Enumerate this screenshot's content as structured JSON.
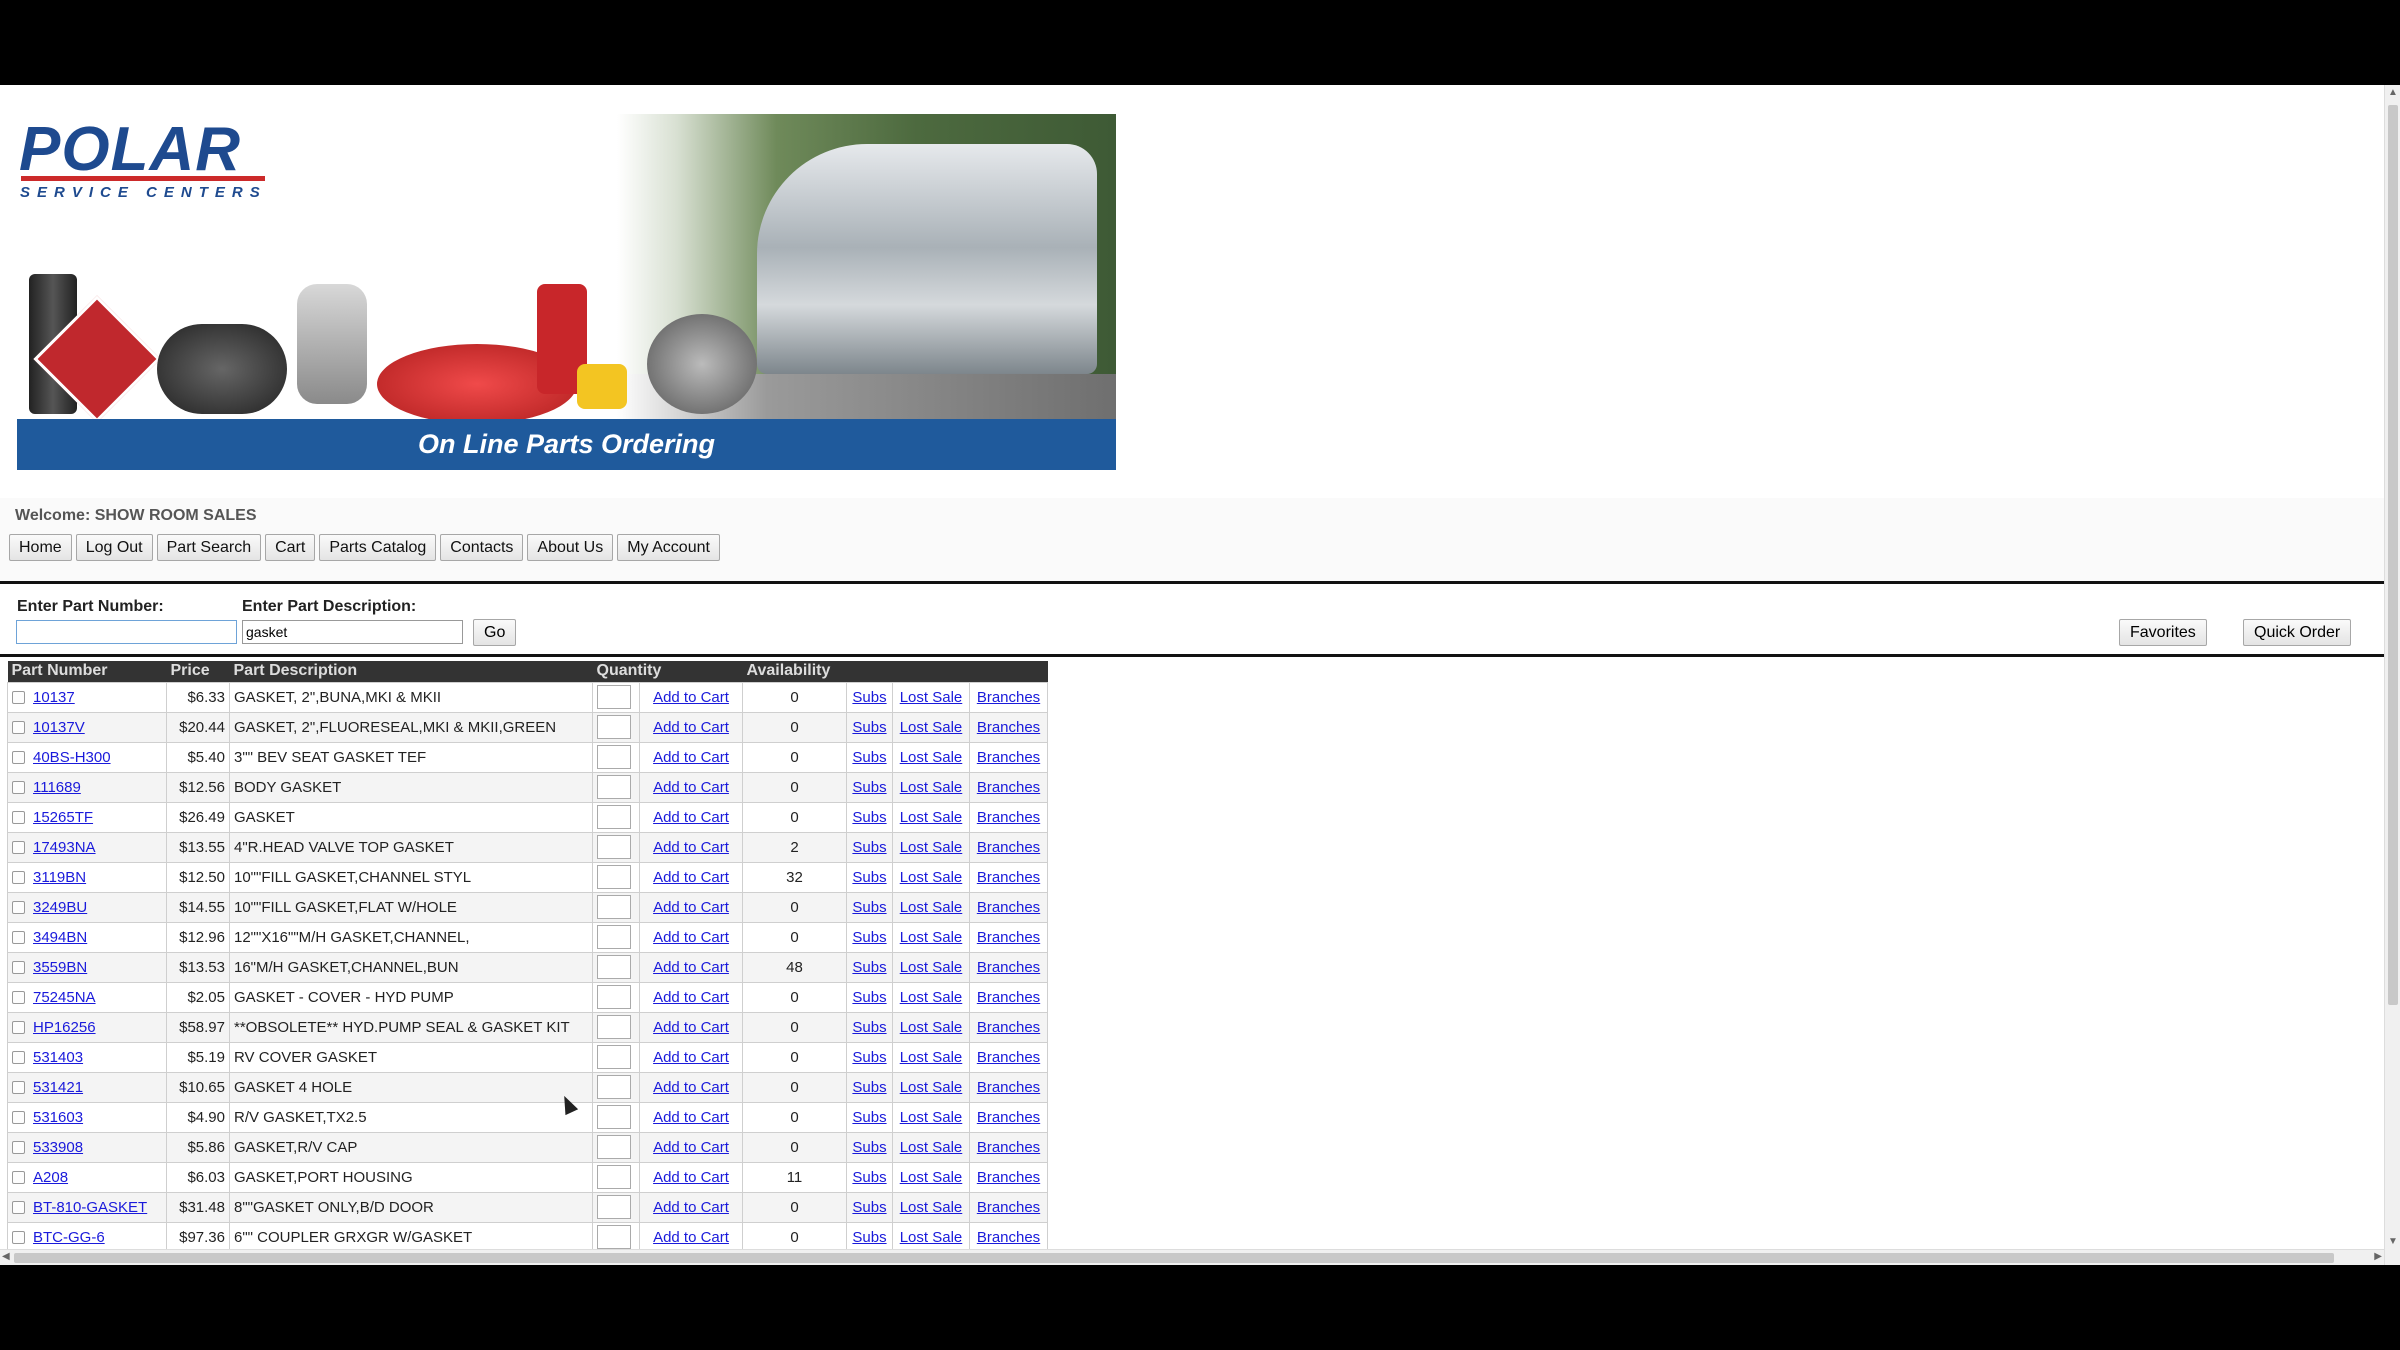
{
  "banner": {
    "logo_text": "POLAR",
    "logo_subtext": "SERVICE CENTERS",
    "strip_text": "On Line Parts Ordering"
  },
  "welcome_text": "Welcome: SHOW ROOM SALES",
  "nav": [
    "Home",
    "Log Out",
    "Part Search",
    "Cart",
    "Parts Catalog",
    "Contacts",
    "About Us",
    "My Account"
  ],
  "search": {
    "part_number_label": "Enter Part Number:",
    "part_number_value": "",
    "part_description_label": "Enter Part Description:",
    "part_description_value": "gasket",
    "go_label": "Go",
    "favorites_label": "Favorites",
    "quick_order_label": "Quick Order"
  },
  "table": {
    "headers": [
      "Part Number",
      "Price",
      "Part Description",
      "Quantity",
      "Availability"
    ],
    "add_label": "Add to Cart",
    "subs_label": "Subs",
    "lost_label": "Lost Sale",
    "branches_label": "Branches",
    "rows": [
      {
        "part": "10137",
        "price": "$6.33",
        "desc": "GASKET, 2\",BUNA,MKI & MKII",
        "avail": "0"
      },
      {
        "part": "10137V",
        "price": "$20.44",
        "desc": "GASKET, 2\",FLUORESEAL,MKI & MKII,GREEN",
        "avail": "0"
      },
      {
        "part": "40BS-H300",
        "price": "$5.40",
        "desc": "3\"\" BEV SEAT GASKET TEF",
        "avail": "0"
      },
      {
        "part": "111689",
        "price": "$12.56",
        "desc": "BODY GASKET",
        "avail": "0"
      },
      {
        "part": "15265TF",
        "price": "$26.49",
        "desc": "GASKET",
        "avail": "0"
      },
      {
        "part": "17493NA",
        "price": "$13.55",
        "desc": "4\"R.HEAD VALVE TOP GASKET",
        "avail": "2"
      },
      {
        "part": "3119BN",
        "price": "$12.50",
        "desc": "10\"\"FILL GASKET,CHANNEL STYL",
        "avail": "32"
      },
      {
        "part": "3249BU",
        "price": "$14.55",
        "desc": "10\"\"FILL GASKET,FLAT W/HOLE",
        "avail": "0"
      },
      {
        "part": "3494BN",
        "price": "$12.96",
        "desc": "12\"\"X16\"\"M/H GASKET,CHANNEL,",
        "avail": "0"
      },
      {
        "part": "3559BN",
        "price": "$13.53",
        "desc": "16\"M/H GASKET,CHANNEL,BUN",
        "avail": "48"
      },
      {
        "part": "75245NA",
        "price": "$2.05",
        "desc": "GASKET - COVER - HYD PUMP",
        "avail": "0"
      },
      {
        "part": "HP16256",
        "price": "$58.97",
        "desc": "**OBSOLETE** HYD.PUMP SEAL & GASKET KIT",
        "avail": "0"
      },
      {
        "part": "531403",
        "price": "$5.19",
        "desc": "RV COVER GASKET",
        "avail": "0"
      },
      {
        "part": "531421",
        "price": "$10.65",
        "desc": "GASKET 4 HOLE",
        "avail": "0"
      },
      {
        "part": "531603",
        "price": "$4.90",
        "desc": "R/V GASKET,TX2.5",
        "avail": "0"
      },
      {
        "part": "533908",
        "price": "$5.86",
        "desc": "GASKET,R/V CAP",
        "avail": "0"
      },
      {
        "part": "A208",
        "price": "$6.03",
        "desc": "GASKET,PORT HOUSING",
        "avail": "11"
      },
      {
        "part": "BT-810-GASKET",
        "price": "$31.48",
        "desc": "8\"\"GASKET ONLY,B/D DOOR",
        "avail": "0"
      },
      {
        "part": "BTC-GG-6",
        "price": "$97.36",
        "desc": "6\"\" COUPLER GRXGR W/GASKET",
        "avail": "0"
      }
    ]
  }
}
